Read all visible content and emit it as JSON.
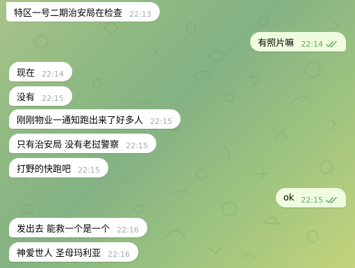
{
  "chat": {
    "messages": [
      {
        "direction": "in",
        "text": "特区一号二期治安局在检查",
        "time": "22:13"
      },
      {
        "direction": "out",
        "text": "有照片嘛",
        "time": "22:14",
        "status": "read"
      },
      {
        "direction": "in",
        "text": "现在",
        "time": "22:14"
      },
      {
        "direction": "in",
        "text": "没有",
        "time": "22:15"
      },
      {
        "direction": "in",
        "text": "刚刚物业一通知跑出来了好多人",
        "time": "22:15"
      },
      {
        "direction": "in",
        "text": "只有治安局 没有老挝警察",
        "time": "22:15"
      },
      {
        "direction": "in",
        "text": "打野的快跑吧",
        "time": "22:15"
      },
      {
        "direction": "out",
        "text": "ok",
        "time": "22:15",
        "status": "read"
      },
      {
        "direction": "in",
        "text": "发出去 能救一个是一个",
        "time": "22:16"
      },
      {
        "direction": "in",
        "text": "神爱世人 圣母玛利亚",
        "time": "22:16"
      }
    ]
  },
  "colors": {
    "incoming_bubble": "#ffffff",
    "outgoing_bubble": "#effdde",
    "read_check": "#5fa96a",
    "timestamp": "#a0acb6"
  },
  "icons": {
    "read_receipt": "double-check-icon",
    "background": "doodle-pattern"
  }
}
